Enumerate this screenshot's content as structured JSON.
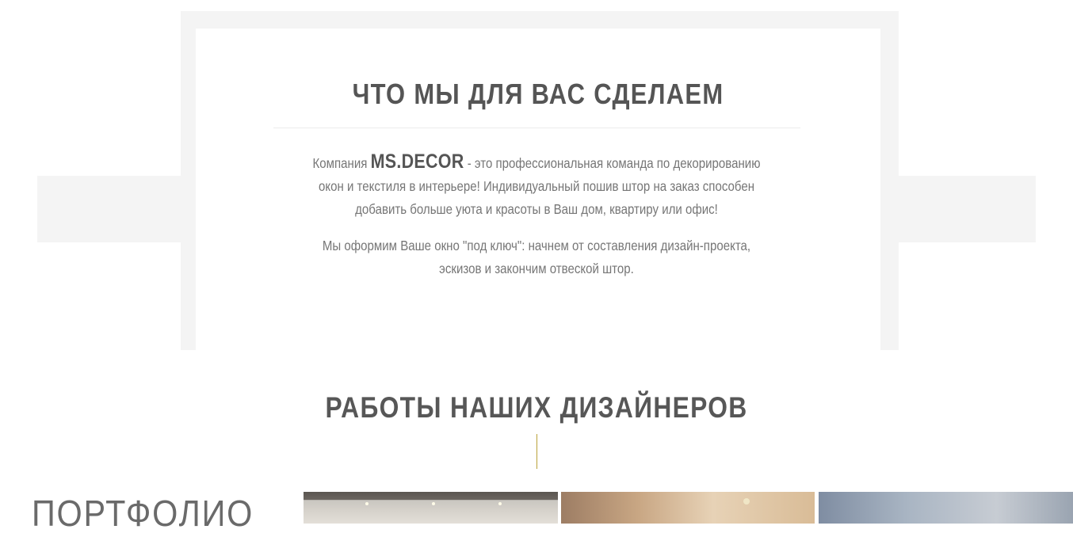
{
  "about": {
    "heading": "ЧТО МЫ ДЛЯ ВАС СДЕЛАЕМ",
    "p1_prefix": "Компания ",
    "brand": "MS.DECOR",
    "p1_suffix": " - это профессиональная команда по декорированию окон и текстиля в интерьере! Индивидуальный пошив штор на заказ способен добавить больше уюта и красоты в Ваш дом, квартиру или офис!",
    "p2": "Мы оформим Ваше окно \"под ключ\": начнем от составления дизайн-проекта, эскизов и закончим отвеской штор."
  },
  "works": {
    "heading": "РАБОТЫ НАШИХ ДИЗАЙНЕРОВ",
    "accent_color": "#b9a23a"
  },
  "portfolio": {
    "label": "ПОРТФОЛИО"
  }
}
